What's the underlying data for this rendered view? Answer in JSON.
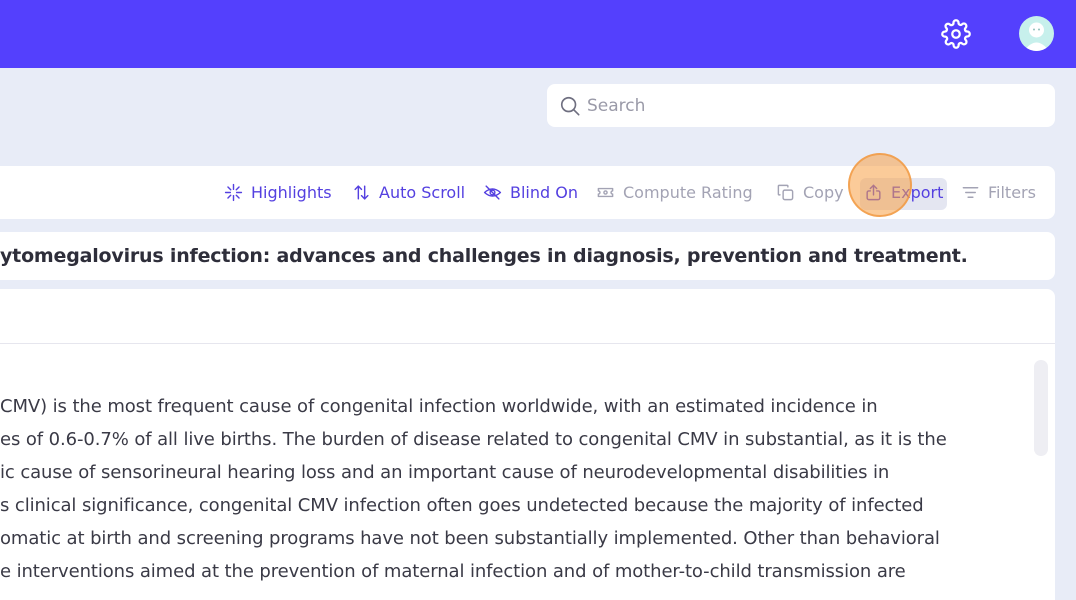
{
  "header": {
    "settings_icon": "gear-icon",
    "avatar_icon": "user-avatar"
  },
  "search": {
    "placeholder": "Search",
    "value": ""
  },
  "toolbar": {
    "highlights": "Highlights",
    "auto_scroll": "Auto Scroll",
    "blind_on": "Blind On",
    "compute_rating": "Compute Rating",
    "copy": "Copy",
    "export": "Export",
    "filters": "Filters"
  },
  "article": {
    "title": "ytomegalovirus infection: advances and challenges in diagnosis, prevention and treatment.",
    "abstract_lines": [
      "CMV) is the most frequent cause of congenital infection worldwide, with an estimated incidence in",
      "es of 0.6-0.7% of all live births. The burden of disease related to congenital CMV in substantial, as it is the",
      "ic cause of sensorineural hearing loss and an important cause of neurodevelopmental disabilities in",
      "s clinical significance, congenital CMV infection often goes undetected because the majority of infected",
      "omatic at birth and screening programs have not been substantially implemented. Other than behavioral",
      "e interventions aimed at the prevention of maternal infection and of mother-to-child transmission are"
    ]
  },
  "colors": {
    "brand": "#5440fd",
    "active_tool": "#5440e0",
    "muted_tool": "#a3a3b4",
    "highlight": "#efe0fb"
  }
}
